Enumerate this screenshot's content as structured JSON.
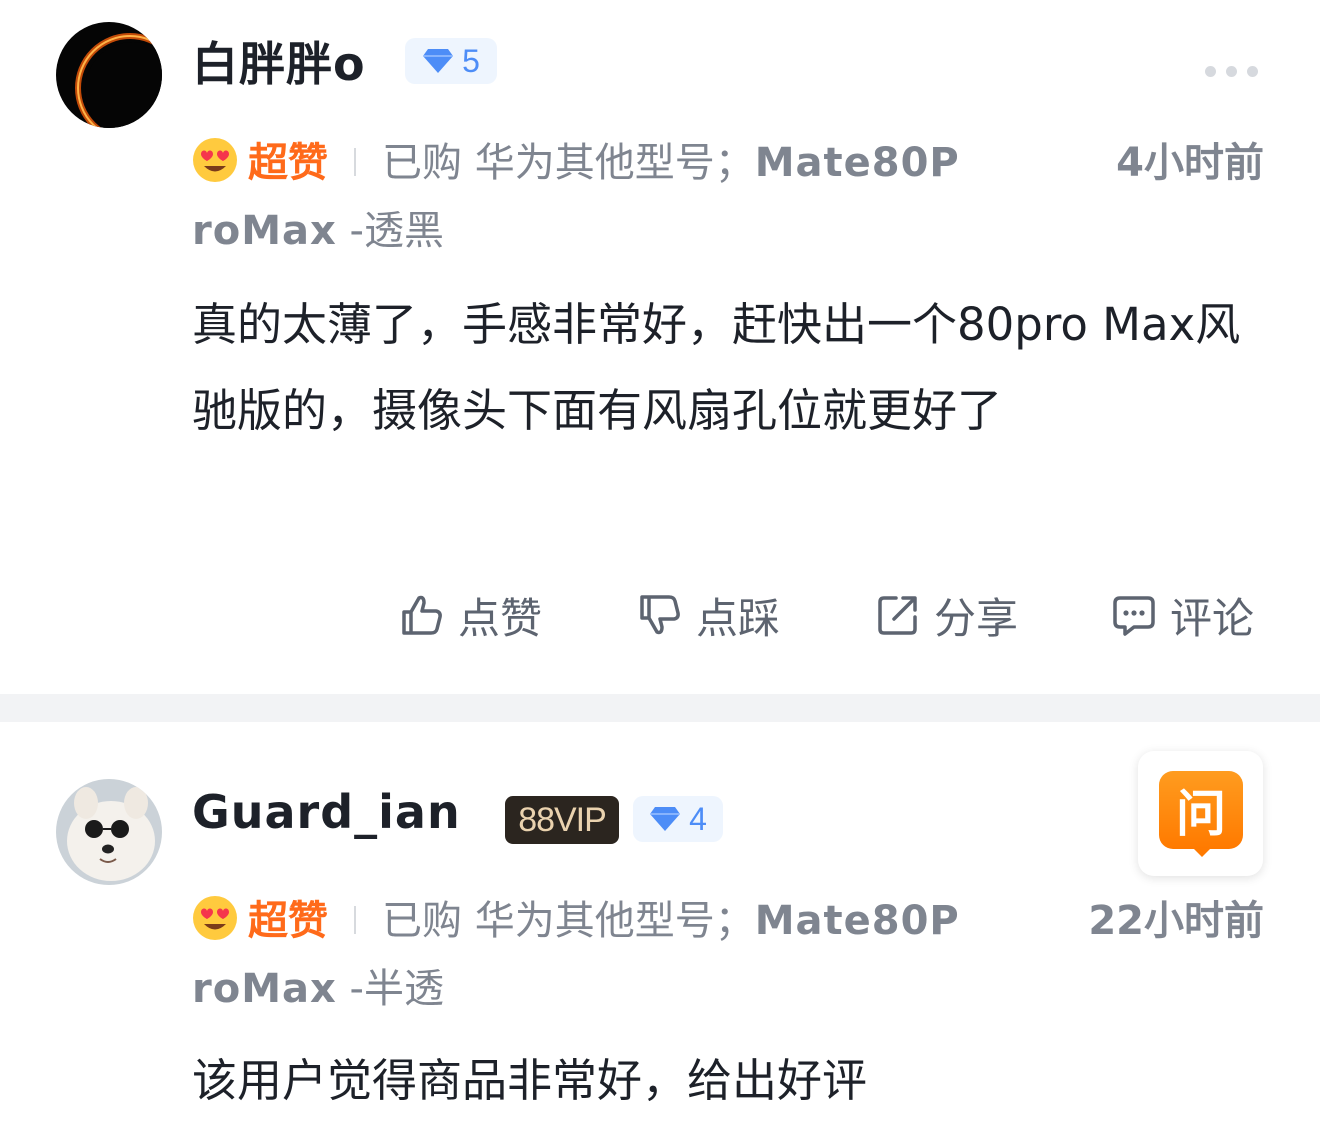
{
  "reviews": [
    {
      "username": "白胖胖o",
      "level": "5",
      "vip": "",
      "rating_label": "超赞",
      "purchase_line1": "已购 华为其他型号；",
      "model_part1": "Mate80P",
      "model_part2": "roMax",
      "variant": "-透黑",
      "time": "4小时前",
      "content": "真的太薄了，手感非常好，赶快出一个80pro Max风驰版的，摄像头下面有风扇孔位就更好了"
    },
    {
      "username": "Guard_ian",
      "level": "4",
      "vip": "88VIP",
      "rating_label": "超赞",
      "purchase_line1": "已购 华为其他型号；",
      "model_part1": "Mate80P",
      "model_part2": "roMax",
      "variant": "-半透",
      "time": "22小时前",
      "content": "该用户觉得商品非常好，给出好评"
    }
  ],
  "actions": {
    "like": "点赞",
    "dislike": "点踩",
    "share": "分享",
    "comment": "评论"
  },
  "ask_button": "问",
  "icons": {
    "level": "diamond-icon",
    "rating": "heart-eyes-emoji-icon",
    "like": "thumbs-up-icon",
    "dislike": "thumbs-down-icon",
    "share": "share-icon",
    "comment": "comment-icon",
    "more": "more-dots-icon"
  },
  "colors": {
    "rating": "#ff6a1a",
    "level_badge": "#4d8df7",
    "ask": "#ff8a00",
    "vip_bg": "#2b251f",
    "vip_text": "#ead2ae"
  }
}
